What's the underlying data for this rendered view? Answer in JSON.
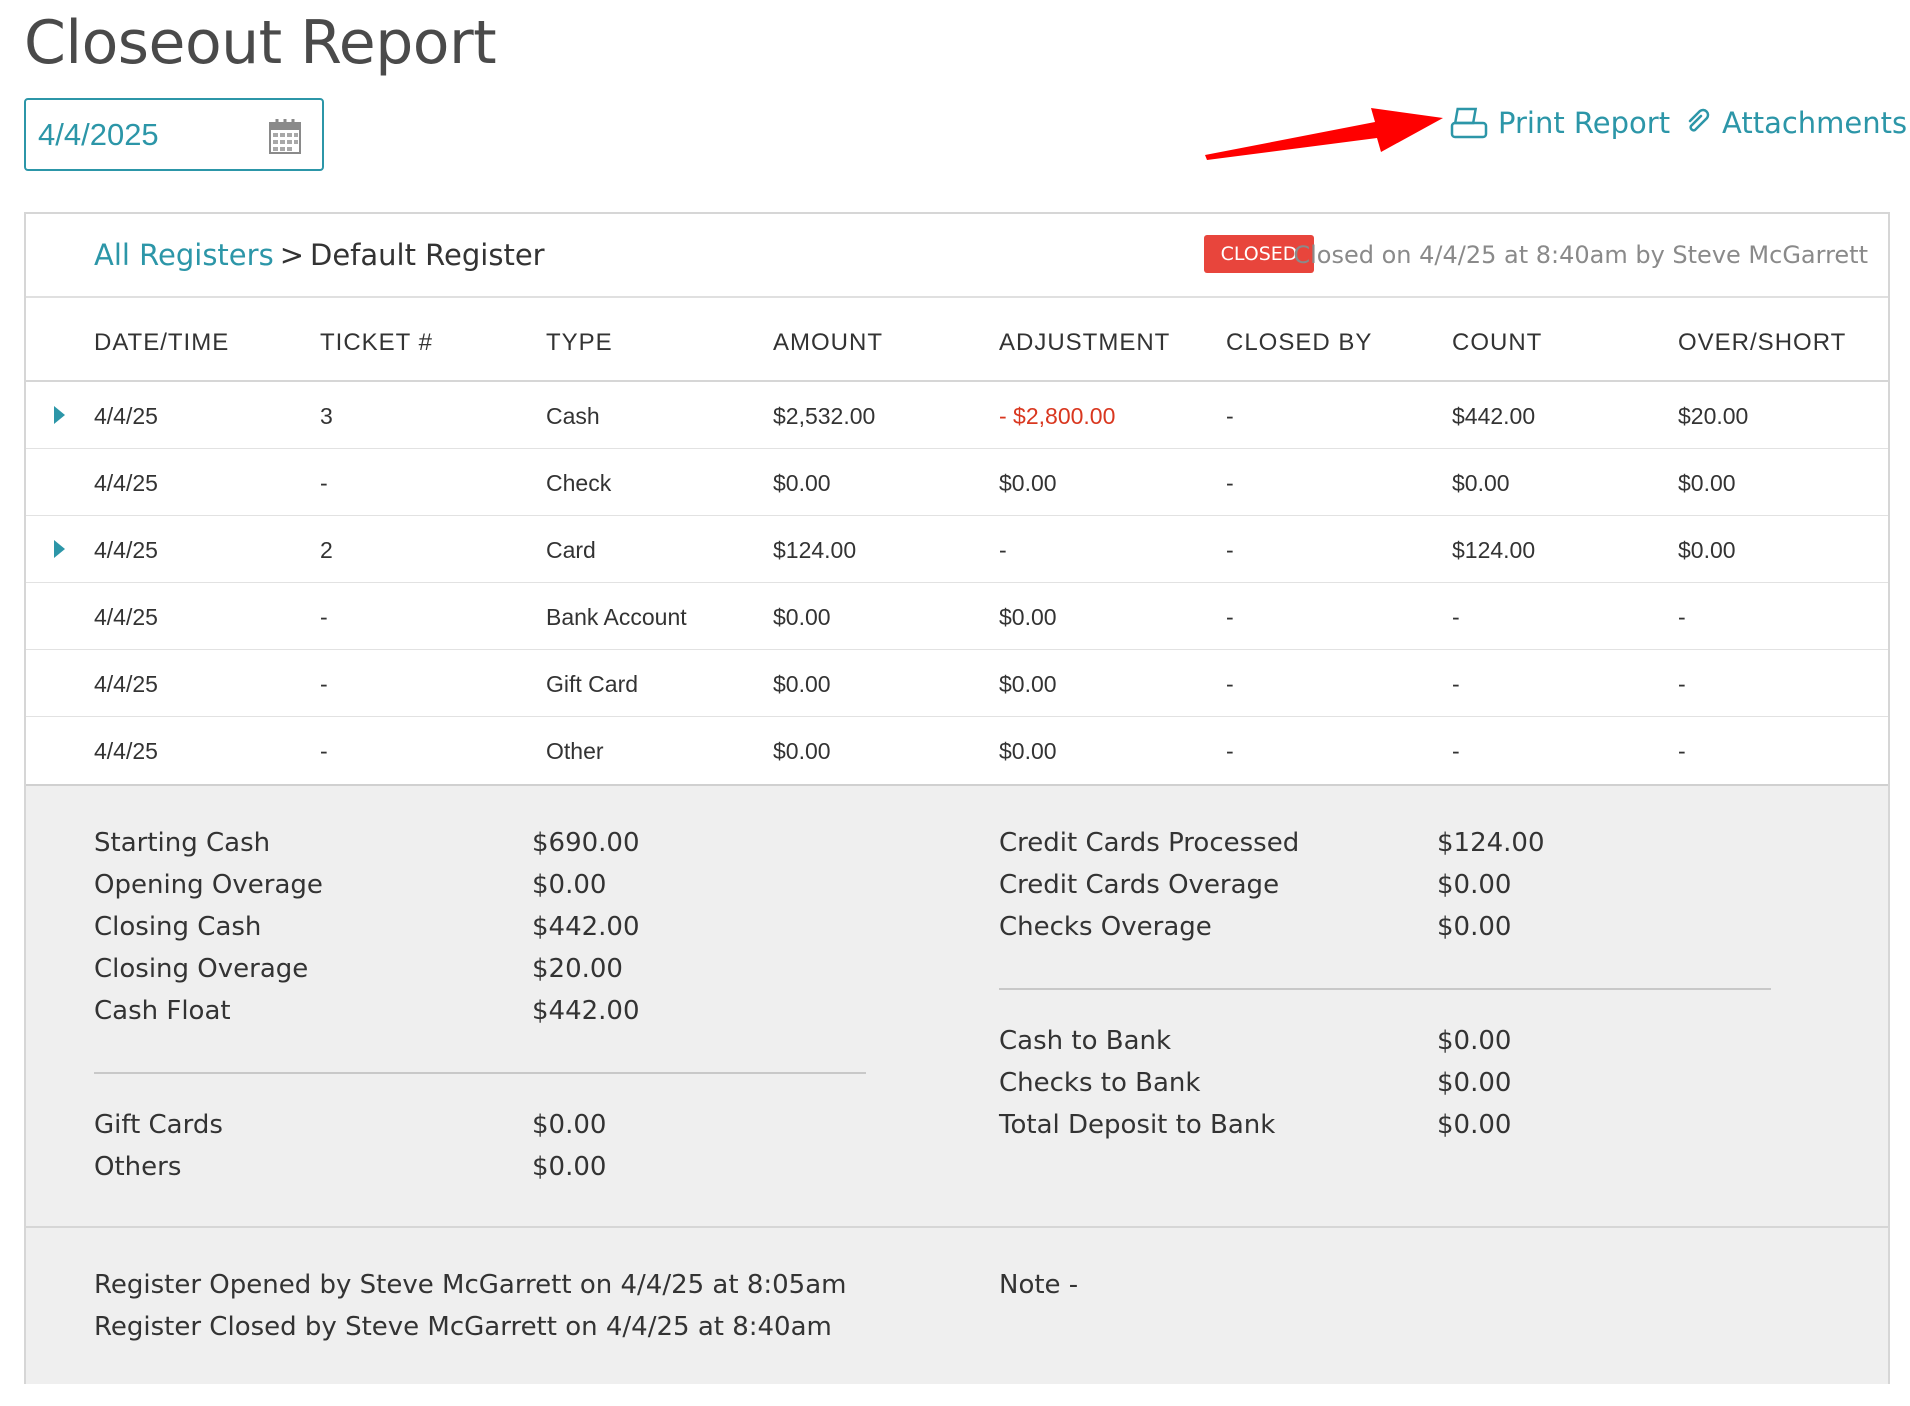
{
  "page": {
    "title": "Closeout Report",
    "date_value": "4/4/2025"
  },
  "toolbar": {
    "print_label": "Print Report",
    "attachments_label": "Attachments"
  },
  "colors": {
    "accent": "#2c96a8",
    "closed_badge": "#e8453c",
    "negative": "#d9371f",
    "annotation_arrow": "#ff0000"
  },
  "header": {
    "breadcrumb_link": "All Registers",
    "breadcrumb_sep": ">",
    "breadcrumb_current": "Default Register",
    "status": "CLOSED",
    "closed_info": "Closed on 4/4/25 at 8:40am by Steve McGarrett"
  },
  "table": {
    "columns": [
      "DATE/TIME",
      "TICKET #",
      "TYPE",
      "AMOUNT",
      "ADJUSTMENT",
      "CLOSED BY",
      "COUNT",
      "OVER/SHORT"
    ],
    "rows": [
      {
        "expandable": true,
        "cells": [
          "4/4/25",
          "3",
          "Cash",
          "$2,532.00",
          "- $2,800.00",
          "-",
          "$442.00",
          "$20.00"
        ],
        "negative_adjustment": true
      },
      {
        "expandable": false,
        "cells": [
          "4/4/25",
          "-",
          "Check",
          "$0.00",
          "$0.00",
          "-",
          "$0.00",
          "$0.00"
        ]
      },
      {
        "expandable": true,
        "cells": [
          "4/4/25",
          "2",
          "Card",
          "$124.00",
          "-",
          "-",
          "$124.00",
          "$0.00"
        ]
      },
      {
        "expandable": false,
        "cells": [
          "4/4/25",
          "-",
          "Bank Account",
          "$0.00",
          "$0.00",
          "-",
          "-",
          "-"
        ]
      },
      {
        "expandable": false,
        "cells": [
          "4/4/25",
          "-",
          "Gift Card",
          "$0.00",
          "$0.00",
          "-",
          "-",
          "-"
        ]
      },
      {
        "expandable": false,
        "cells": [
          "4/4/25",
          "-",
          "Other",
          "$0.00",
          "$0.00",
          "-",
          "-",
          "-"
        ]
      }
    ]
  },
  "summary": {
    "left_top": [
      {
        "label": "Starting Cash",
        "value": "$690.00"
      },
      {
        "label": "Opening Overage",
        "value": "$0.00"
      },
      {
        "label": "Closing Cash",
        "value": "$442.00"
      },
      {
        "label": "Closing Overage",
        "value": "$20.00"
      },
      {
        "label": "Cash Float",
        "value": "$442.00"
      }
    ],
    "left_bottom": [
      {
        "label": "Gift Cards",
        "value": "$0.00"
      },
      {
        "label": "Others",
        "value": "$0.00"
      }
    ],
    "right_top": [
      {
        "label": "Credit Cards Processed",
        "value": "$124.00"
      },
      {
        "label": "Credit Cards Overage",
        "value": "$0.00"
      },
      {
        "label": "Checks Overage",
        "value": "$0.00"
      }
    ],
    "right_bottom": [
      {
        "label": "Cash to Bank",
        "value": "$0.00"
      },
      {
        "label": "Checks to Bank",
        "value": "$0.00"
      },
      {
        "label": "Total Deposit to Bank",
        "value": "$0.00"
      }
    ]
  },
  "footer": {
    "opened_text": "Register Opened by Steve McGarrett on 4/4/25 at 8:05am",
    "closed_text": "Register Closed by Steve McGarrett on 4/4/25 at 8:40am",
    "note_text": "Note -"
  }
}
